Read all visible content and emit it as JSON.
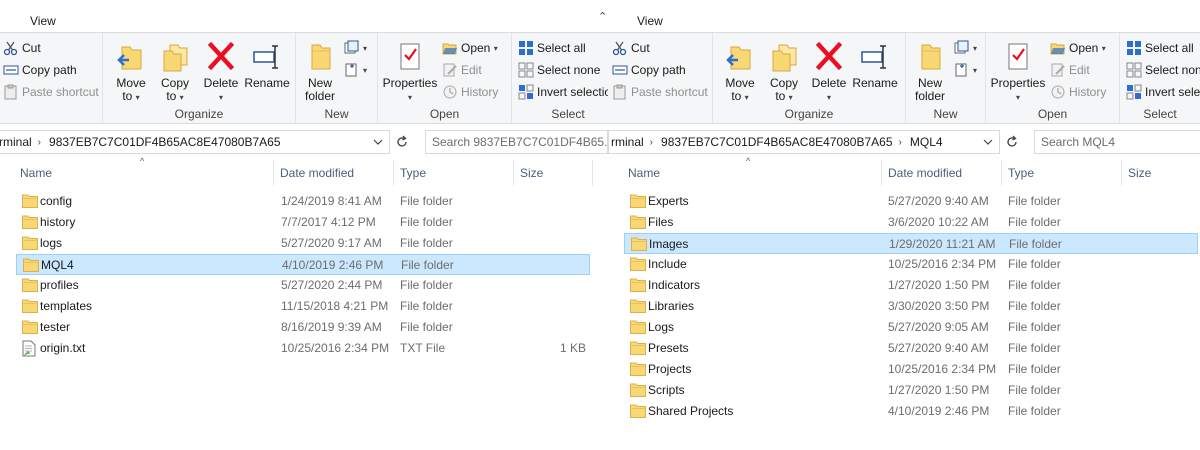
{
  "left": {
    "ribbon": {
      "tab_view": "View",
      "clipboard": {
        "cut": "Cut",
        "copy_path": "Copy path",
        "paste_shortcut": "Paste shortcut"
      },
      "organize": {
        "move_to": [
          "Move",
          "to"
        ],
        "copy_to": [
          "Copy",
          "to"
        ],
        "delete": "Delete",
        "rename": "Rename",
        "label": "Organize"
      },
      "new": {
        "new_folder": [
          "New",
          "folder"
        ],
        "label": "New"
      },
      "open": {
        "properties": "Properties",
        "open": "Open",
        "edit": "Edit",
        "history": "History",
        "label": "Open"
      },
      "select": {
        "select_all": "Select all",
        "select_none": "Select none",
        "invert_selection": "Invert selection",
        "label": "Select"
      }
    },
    "address": {
      "crumb": "rminal",
      "path": "9837EB7C7C01DF4B65AC8E47080B7A65"
    },
    "search": {
      "placeholder": "Search 9837EB7C7C01DF4B65..."
    },
    "columns": [
      "Name",
      "Date modified",
      "Type",
      "Size"
    ],
    "rows": [
      {
        "name": "config",
        "date": "1/24/2019 8:41 AM",
        "type": "File folder",
        "size": "",
        "kind": "folder"
      },
      {
        "name": "history",
        "date": "7/7/2017 4:12 PM",
        "type": "File folder",
        "size": "",
        "kind": "folder"
      },
      {
        "name": "logs",
        "date": "5/27/2020 9:17 AM",
        "type": "File folder",
        "size": "",
        "kind": "folder"
      },
      {
        "name": "MQL4",
        "date": "4/10/2019 2:46 PM",
        "type": "File folder",
        "size": "",
        "kind": "folder",
        "selected": true
      },
      {
        "name": "profiles",
        "date": "5/27/2020 2:44 PM",
        "type": "File folder",
        "size": "",
        "kind": "folder"
      },
      {
        "name": "templates",
        "date": "11/15/2018 4:21 PM",
        "type": "File folder",
        "size": "",
        "kind": "folder"
      },
      {
        "name": "tester",
        "date": "8/16/2019 9:39 AM",
        "type": "File folder",
        "size": "",
        "kind": "folder"
      },
      {
        "name": "origin.txt",
        "date": "10/25/2016 2:34 PM",
        "type": "TXT File",
        "size": "1 KB",
        "kind": "txt"
      }
    ]
  },
  "right": {
    "ribbon": {
      "tab_view": "View",
      "clipboard": {
        "cut": "Cut",
        "copy_path": "Copy path",
        "paste_shortcut": "Paste shortcut"
      },
      "organize": {
        "move_to": [
          "Move",
          "to"
        ],
        "copy_to": [
          "Copy",
          "to"
        ],
        "delete": "Delete",
        "rename": "Rename",
        "label": "Organize"
      },
      "new": {
        "new_folder": [
          "New",
          "folder"
        ],
        "label": "New"
      },
      "open": {
        "properties": "Properties",
        "open": "Open",
        "edit": "Edit",
        "history": "History",
        "label": "Open"
      },
      "select": {
        "select_all": "Select all",
        "select_none": "Select none",
        "invert_selection": "Invert selection",
        "label": "Select"
      }
    },
    "address": {
      "crumb": "rminal",
      "path": "9837EB7C7C01DF4B65AC8E47080B7A65",
      "leaf": "MQL4"
    },
    "search": {
      "placeholder": "Search MQL4"
    },
    "columns": [
      "Name",
      "Date modified",
      "Type",
      "Size"
    ],
    "rows": [
      {
        "name": "Experts",
        "date": "5/27/2020 9:40 AM",
        "type": "File folder",
        "size": "",
        "kind": "folder"
      },
      {
        "name": "Files",
        "date": "3/6/2020 10:22 AM",
        "type": "File folder",
        "size": "",
        "kind": "folder"
      },
      {
        "name": "Images",
        "date": "1/29/2020 11:21 AM",
        "type": "File folder",
        "size": "",
        "kind": "folder",
        "selected": true
      },
      {
        "name": "Include",
        "date": "10/25/2016 2:34 PM",
        "type": "File folder",
        "size": "",
        "kind": "folder"
      },
      {
        "name": "Indicators",
        "date": "1/27/2020 1:50 PM",
        "type": "File folder",
        "size": "",
        "kind": "folder"
      },
      {
        "name": "Libraries",
        "date": "3/30/2020 3:50 PM",
        "type": "File folder",
        "size": "",
        "kind": "folder"
      },
      {
        "name": "Logs",
        "date": "5/27/2020 9:05 AM",
        "type": "File folder",
        "size": "",
        "kind": "folder"
      },
      {
        "name": "Presets",
        "date": "5/27/2020 9:40 AM",
        "type": "File folder",
        "size": "",
        "kind": "folder"
      },
      {
        "name": "Projects",
        "date": "10/25/2016 2:34 PM",
        "type": "File folder",
        "size": "",
        "kind": "folder"
      },
      {
        "name": "Scripts",
        "date": "1/27/2020 1:50 PM",
        "type": "File folder",
        "size": "",
        "kind": "folder"
      },
      {
        "name": "Shared Projects",
        "date": "4/10/2019 2:46 PM",
        "type": "File folder",
        "size": "",
        "kind": "folder"
      }
    ]
  },
  "colors": {
    "selection_fill": "#cce8ff",
    "selection_border": "#99d1ff",
    "folder_yellow": "#f8d775",
    "header_text": "#4c607a",
    "delete_red": "#e81123"
  }
}
